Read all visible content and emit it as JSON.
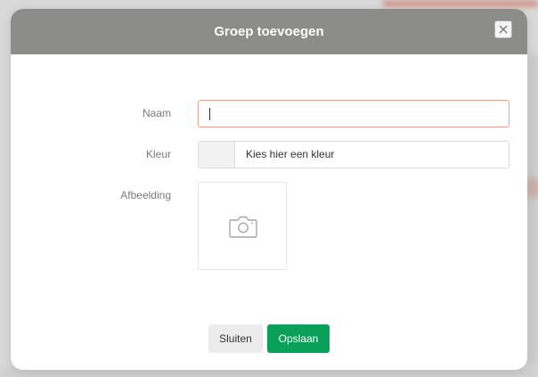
{
  "dialog": {
    "title": "Groep toevoegen",
    "close_icon": "close-icon",
    "header_color": "#8c8c8a"
  },
  "form": {
    "name": {
      "label": "Naam",
      "value": ""
    },
    "color": {
      "label": "Kleur",
      "placeholder": "Kies hier een kleur"
    },
    "image": {
      "label": "Afbeelding",
      "icon": "camera-icon"
    }
  },
  "buttons": {
    "close_label": "Sluiten",
    "save_label": "Opslaan",
    "save_color": "#0aa05a"
  }
}
